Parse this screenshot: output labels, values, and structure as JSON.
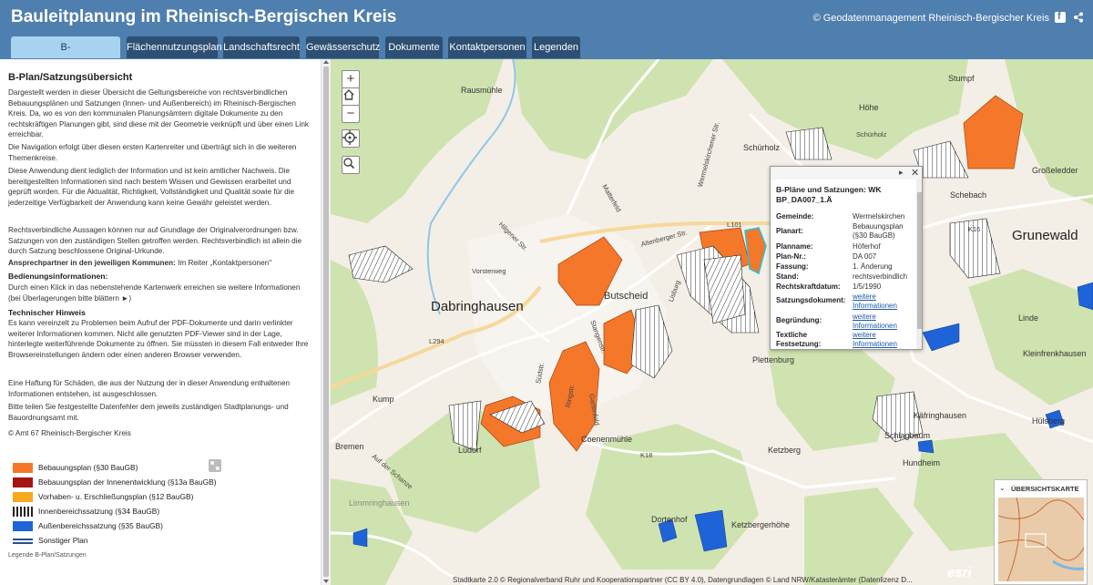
{
  "header": {
    "title": "Bauleitplanung im Rheinisch-Bergischen Kreis",
    "copyright": "© Geodatenmanagement Rheinisch-Bergischer Kreis",
    "facebook_icon": "facebook-icon",
    "share_icon": "share-icon"
  },
  "tabs": [
    {
      "label": "B-Plan/Satzungsübersicht",
      "active": true
    },
    {
      "label": "Flächennutzungsplan",
      "active": false
    },
    {
      "label": "Landschaftsrecht",
      "active": false
    },
    {
      "label": "Gewässerschutz",
      "active": false
    },
    {
      "label": "Dokumente",
      "active": false
    },
    {
      "label": "Kontaktpersonen",
      "active": false
    },
    {
      "label": "Legenden",
      "active": false
    }
  ],
  "sidebar": {
    "title": "B-Plan/Satzungsübersicht",
    "p1": "Dargestellt werden in dieser Übersicht die Geltungsbereiche von rechtsverbindlichen Bebauungsplänen und Satzungen (Innen- und Außenbereich) im Rheinisch-Bergischen Kreis. Da, wo es von den kommunalen Planungsämtern digitale Dokumente zu den rechtskräftigen Planungen gibt, sind diese mit der Geometrie verknüpft und über einen Link erreichbar.",
    "p2": "Die Navigation erfolgt über diesen ersten Kartenreiter und überträgt sich in die weiteren Themenkreise.",
    "p3": "Diese Anwendung dient lediglich der Information und ist kein amtlicher Nachweis. Die bereitgestellten Informationen sind nach bestem Wissen und Gewissen erarbeitet und geprüft worden. Für die Aktualität, Richtigkeit, Vollständigkeit und Qualität sowie für die jederzeitige Verfügbarkeit der Anwendung kann keine Gewähr geleistet werden.",
    "p4": "Rechtsverbindliche Aussagen können nur auf Grundlage der Originalverordnungen bzw. Satzungen von den zuständigen Stellen getroffen werden. Rechtsverbindlich ist allein die durch Satzung beschlossene Original-Urkunde.",
    "p5_bold": "Ansprechpartner in den jeweiligen Kommunen:",
    "p5_rest": " Im Reiter „Kontaktpersonen\"",
    "h_usage": "Bedienungsinformationen:",
    "p6": "Durch einen Klick in das nebenstehende Kartenwerk erreichen sie weitere Informationen (bei Überlagerungen bitte blättern ►)",
    "h_tech": "Technischer Hinweis",
    "p7": "Es kann vereinzelt zu Problemen beim Aufruf der PDF-Dokumente und darin verlinkter weiterer Informationen kommen. Nicht alle genutzten PDF-Viewer sind in der Lage, hinterlegte weiterführende Dokumente zu öffnen. Sie müssten in diesem Fall entweder Ihre Browsereinstellungen ändern oder einen anderen Browser verwenden.",
    "p8": "Eine Haftung für Schäden, die aus der Nutzung der in dieser Anwendung enthaltenen Informationen entstehen, ist ausgeschlossen.",
    "p9": "Bitte teilen Sie festgestellte Datenfehler dem jeweils zuständigen Stadtplanungs- und Bauordnungsamt mit.",
    "p10": "© Amt 67 Rheinisch-Bergischer Kreis"
  },
  "legend": {
    "items": [
      {
        "label": "Bebauungsplan (§30 BauGB)",
        "color": "#f5772a"
      },
      {
        "label": "Bebauungsplan der Innenentwicklung (§13a BauGB)",
        "color": "#a51414"
      },
      {
        "label": "Vorhaben- u. Erschließungsplan (§12 BauGB)",
        "color": "#f7a91e"
      },
      {
        "label": "Innenbereichssatzung (§34 BauGB)",
        "color": "#222222"
      },
      {
        "label": "Außenbereichssatzung (§35 BauGB)",
        "color": "#1f63d8"
      },
      {
        "label": "Sonstiger Plan",
        "color": "#2a4f8a"
      }
    ],
    "footer": "Legende B-Plan/Satzungen",
    "expand_icon": "expand-icon"
  },
  "map": {
    "labels": [
      {
        "text": "Rausmühle",
        "kind": "place"
      },
      {
        "text": "Wermelskirchener Str.",
        "kind": "road"
      },
      {
        "text": "Schürholz",
        "kind": "place"
      },
      {
        "text": "Höhe",
        "kind": "place"
      },
      {
        "text": "Stumpf",
        "kind": "place"
      },
      {
        "text": "Großeledder",
        "kind": "place"
      },
      {
        "text": "Grunewald",
        "kind": "big"
      },
      {
        "text": "Dabringhausen",
        "kind": "big"
      },
      {
        "text": "Butscheid",
        "kind": "big-small"
      },
      {
        "text": "Altenberger Str.",
        "kind": "road"
      },
      {
        "text": "Hilgener Str.",
        "kind": "road"
      },
      {
        "text": "Matterfeld",
        "kind": "road"
      },
      {
        "text": "Kump",
        "kind": "place"
      },
      {
        "text": "Lüdorf",
        "kind": "place"
      },
      {
        "text": "Bremen",
        "kind": "place"
      },
      {
        "text": "Auf der Schanze",
        "kind": "road"
      },
      {
        "text": "Coenenmühle",
        "kind": "place"
      },
      {
        "text": "Plettenburg",
        "kind": "place"
      },
      {
        "text": "Käfringhausen",
        "kind": "place"
      },
      {
        "text": "Hülsberg",
        "kind": "place"
      },
      {
        "text": "Schlagbaum",
        "kind": "place"
      },
      {
        "text": "Hundheim",
        "kind": "place"
      },
      {
        "text": "Ketzberg",
        "kind": "place"
      },
      {
        "text": "Ketzbergerhöhe",
        "kind": "place"
      },
      {
        "text": "Dortenhof",
        "kind": "place"
      },
      {
        "text": "Linde",
        "kind": "place"
      },
      {
        "text": "Kleinfrenkhausen",
        "kind": "place"
      },
      {
        "text": "Limmringhausen",
        "kind": "place"
      },
      {
        "text": "Ringstr.",
        "kind": "road"
      },
      {
        "text": "Südstr.",
        "kind": "road"
      },
      {
        "text": "Gartenfeld",
        "kind": "road"
      },
      {
        "text": "L101",
        "kind": "road"
      },
      {
        "text": "L294",
        "kind": "road"
      },
      {
        "text": "K18",
        "kind": "road"
      },
      {
        "text": "K16",
        "kind": "road"
      },
      {
        "text": "Vorsterweg",
        "kind": "road"
      },
      {
        "text": "Schürholz",
        "kind": "road"
      },
      {
        "text": "Schebach",
        "kind": "place"
      },
      {
        "text": "Stangenstr.",
        "kind": "road"
      },
      {
        "text": "Lisburg",
        "kind": "road"
      }
    ],
    "controls": {
      "zoom_in": "+",
      "zoom_out": "−"
    },
    "attribution": "Stadtkarte 2.0 © Regionalverband Ruhr und Kooperationspartner (CC BY 4.0), Datengrundlagen © Land NRW/Katasterämter (Datenlizenz D...",
    "esri": "esri"
  },
  "popup": {
    "title": "B-Pläne und Satzungen: WK BP_DA007_1.Ä",
    "rows": [
      {
        "key": "Gemeinde:",
        "value": "Wermelskirchen"
      },
      {
        "key": "Planart:",
        "value": "Bebauungsplan (§30 BauGB)"
      },
      {
        "key": "Planname:",
        "value": "Höferhof"
      },
      {
        "key": "Plan-Nr.:",
        "value": "DA 007"
      },
      {
        "key": "Fassung:",
        "value": "1. Änderung"
      },
      {
        "key": "Stand:",
        "value": "rechtsverbindlich"
      },
      {
        "key": "Rechtskraftdatum:",
        "value": "1/5/1990"
      }
    ],
    "links": [
      {
        "key": "Satzungsdokument:",
        "value": "weitere Informationen"
      },
      {
        "key": "Begründung:",
        "value": "weitere Informationen"
      },
      {
        "key": "Textliche Festsetzung:",
        "value": "weitere Informationen"
      }
    ],
    "next_glyph": "▸",
    "close_glyph": "✕"
  },
  "overview": {
    "title": "ÜBERSICHTSKARTE"
  }
}
